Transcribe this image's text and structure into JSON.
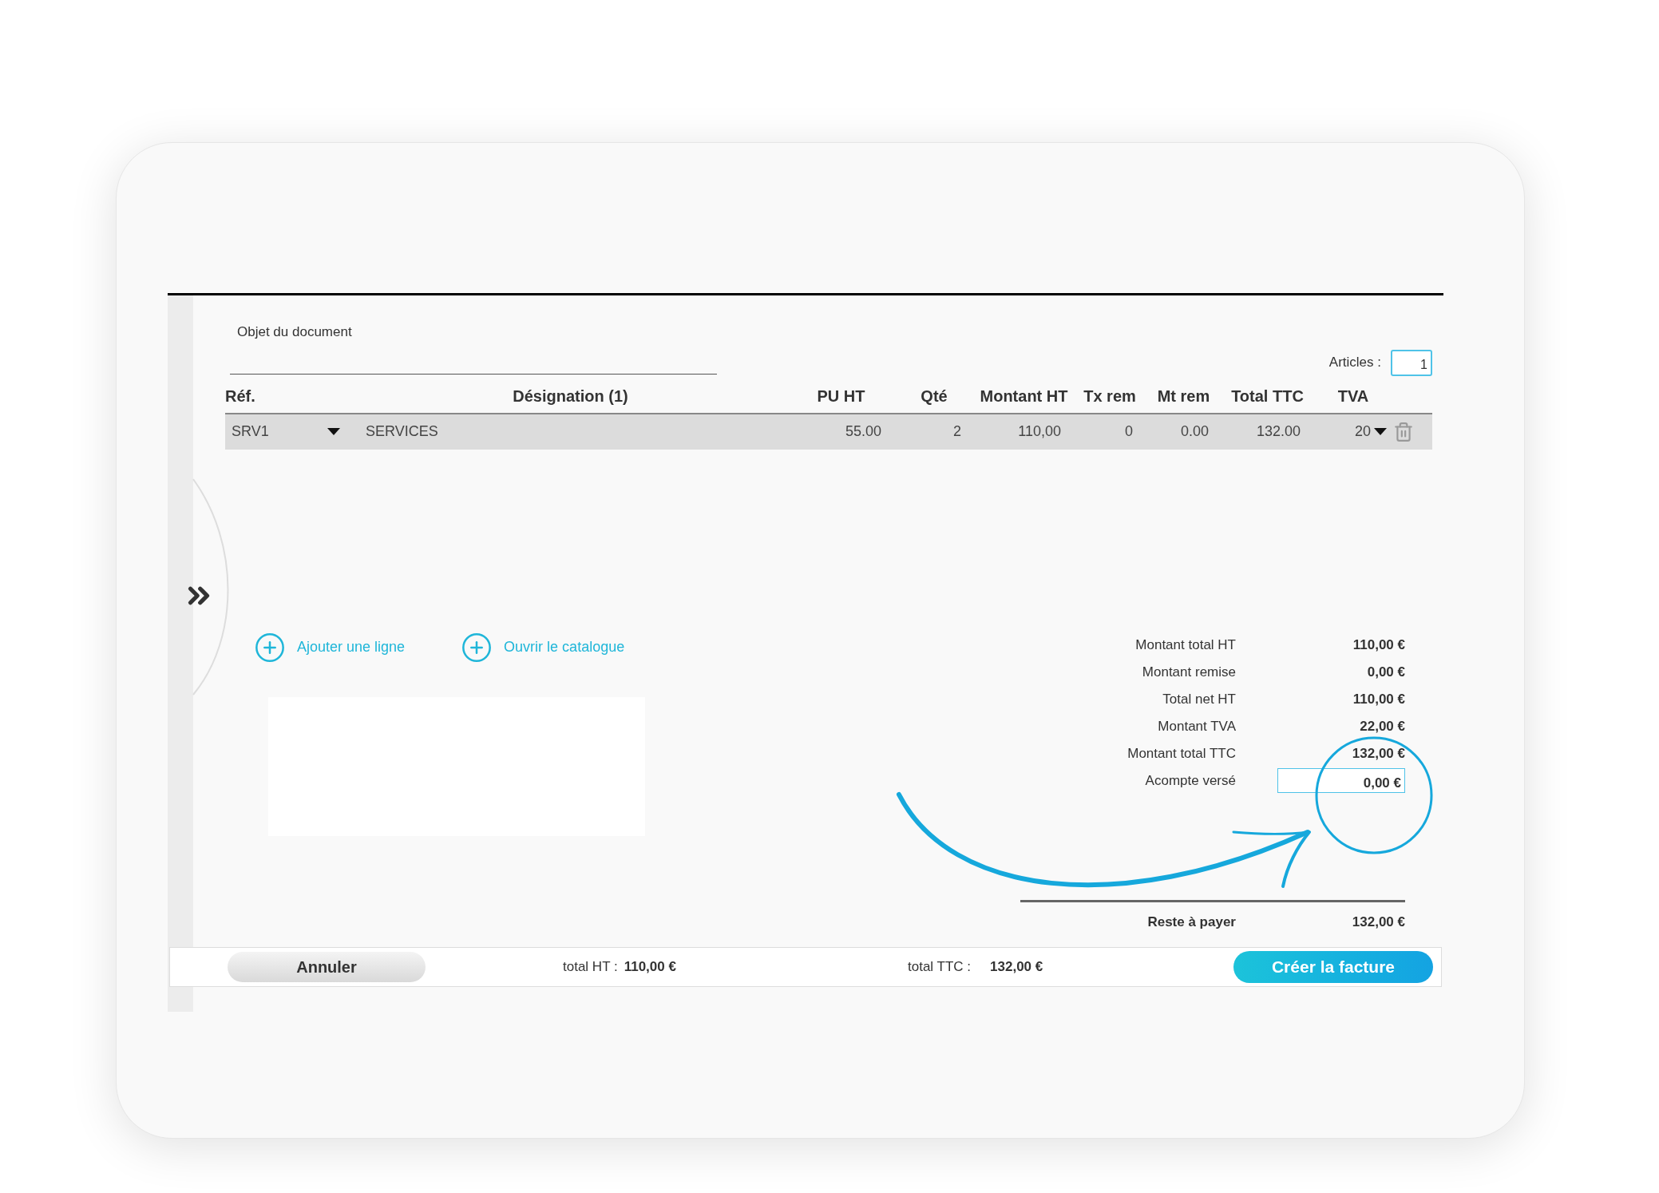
{
  "document": {
    "subject_label": "Objet du document",
    "articles_label": "Articles :",
    "articles_count": "1"
  },
  "table": {
    "columns": [
      "Réf.",
      "Désignation (1)",
      "PU HT",
      "Qté",
      "Montant HT",
      "Tx rem",
      "Mt rem",
      "Total TTC",
      "TVA"
    ],
    "rows": [
      {
        "cells": [
          "SRV1",
          "SERVICES",
          "55.00",
          "2",
          "110,00",
          "0",
          "0.00",
          "132.00",
          "20"
        ]
      }
    ]
  },
  "actions": [
    {
      "label": "Ajouter une ligne"
    },
    {
      "label": "Ouvrir le catalogue"
    }
  ],
  "totals": [
    {
      "label": "Montant total HT",
      "value": "110,00 €",
      "kind": "text"
    },
    {
      "label": "Montant remise",
      "value": "0,00 €",
      "kind": "text"
    },
    {
      "label": "Total net HT",
      "value": "110,00 €",
      "kind": "text"
    },
    {
      "label": "Montant TVA",
      "value": "22,00 €",
      "kind": "text"
    },
    {
      "label": "Montant total TTC",
      "value": "132,00 €",
      "kind": "text"
    },
    {
      "label": "Acompte versé",
      "value": "0,00 €",
      "kind": "input"
    }
  ],
  "balance": {
    "label": "Reste à payer",
    "value": "132,00 €"
  },
  "footer": {
    "cancel": "Annuler",
    "total_ht_label": "total HT :",
    "total_ht": "110,00 €",
    "total_ttc_label": "total TTC :",
    "total_ttc": "132,00 €",
    "create": "Créer la facture"
  }
}
